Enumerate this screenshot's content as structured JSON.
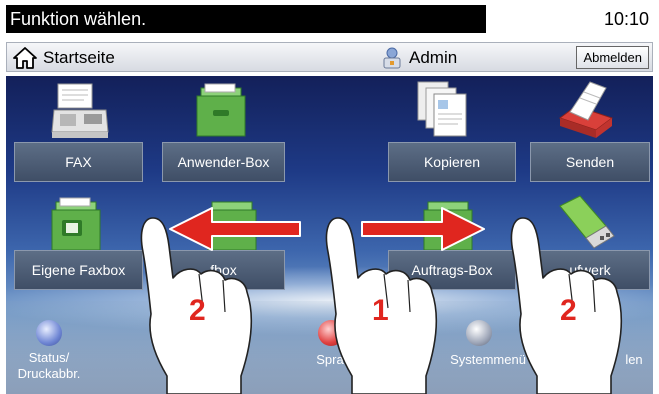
{
  "status": {
    "message": "Funktion wählen.",
    "time": "10:10"
  },
  "header": {
    "home_label": "Startseite",
    "user_label": "Admin",
    "logout_label": "Abmelden"
  },
  "tiles": [
    {
      "label": "FAX",
      "icon": "fax-icon"
    },
    {
      "label": "Anwender-Box",
      "icon": "user-box-icon"
    },
    {
      "label": "Kopieren",
      "icon": "copy-icon"
    },
    {
      "label": "Senden",
      "icon": "send-icon"
    },
    {
      "label": "Eigene Faxbox",
      "icon": "own-faxbox-icon"
    },
    {
      "label": "fbox",
      "icon": "box-icon"
    },
    {
      "label": "Auftrags-Box",
      "icon": "job-box-icon"
    },
    {
      "label": "ufwerk",
      "icon": "usb-drive-icon"
    }
  ],
  "bottom": {
    "status_line1": "Status/",
    "status_line2": "Druckabbr.",
    "item2": "Spra",
    "item3": "Systemmenü",
    "item4": "len"
  },
  "overlay": {
    "number_left": "2",
    "number_center": "1",
    "number_right": "2"
  },
  "colors": {
    "arrow": "#e0261f",
    "number": "#e0261f"
  }
}
